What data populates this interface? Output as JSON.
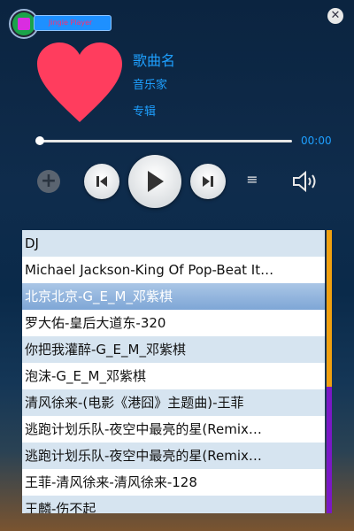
{
  "top_bar": {
    "input_text": "Jingle Player",
    "close_glyph": "✕"
  },
  "now_playing": {
    "title": "歌曲名",
    "artist": "音乐家",
    "album": "专辑",
    "art_icon": "heart-icon",
    "art_color": "#ff3d5e"
  },
  "progress": {
    "time": "00:00",
    "fraction": 0.0
  },
  "controls": {
    "add_glyph": "+",
    "menu_glyph": "≡"
  },
  "playlist": {
    "selected_index": 2,
    "items": [
      "DJ",
      "Michael Jackson-King Of Pop-Beat It…",
      "北京北京-G_E_M_邓紫棋",
      "罗大佑-皇后大道东-320",
      "你把我灌醉-G_E_M_邓紫棋",
      "泡沫-G_E_M_邓紫棋",
      "清风徐来-(电影《港囧》主题曲)-王菲",
      "逃跑计划乐队-夜空中最亮的星(Remix…",
      "逃跑计划乐队-夜空中最亮的星(Remix…",
      "王菲-清风徐来-清风徐来-128",
      "王麟-伤不起"
    ]
  },
  "colors": {
    "accent": "#1ea0ff",
    "scroll_thumb": "#f0a010",
    "scroll_track": "#7a18c6"
  }
}
